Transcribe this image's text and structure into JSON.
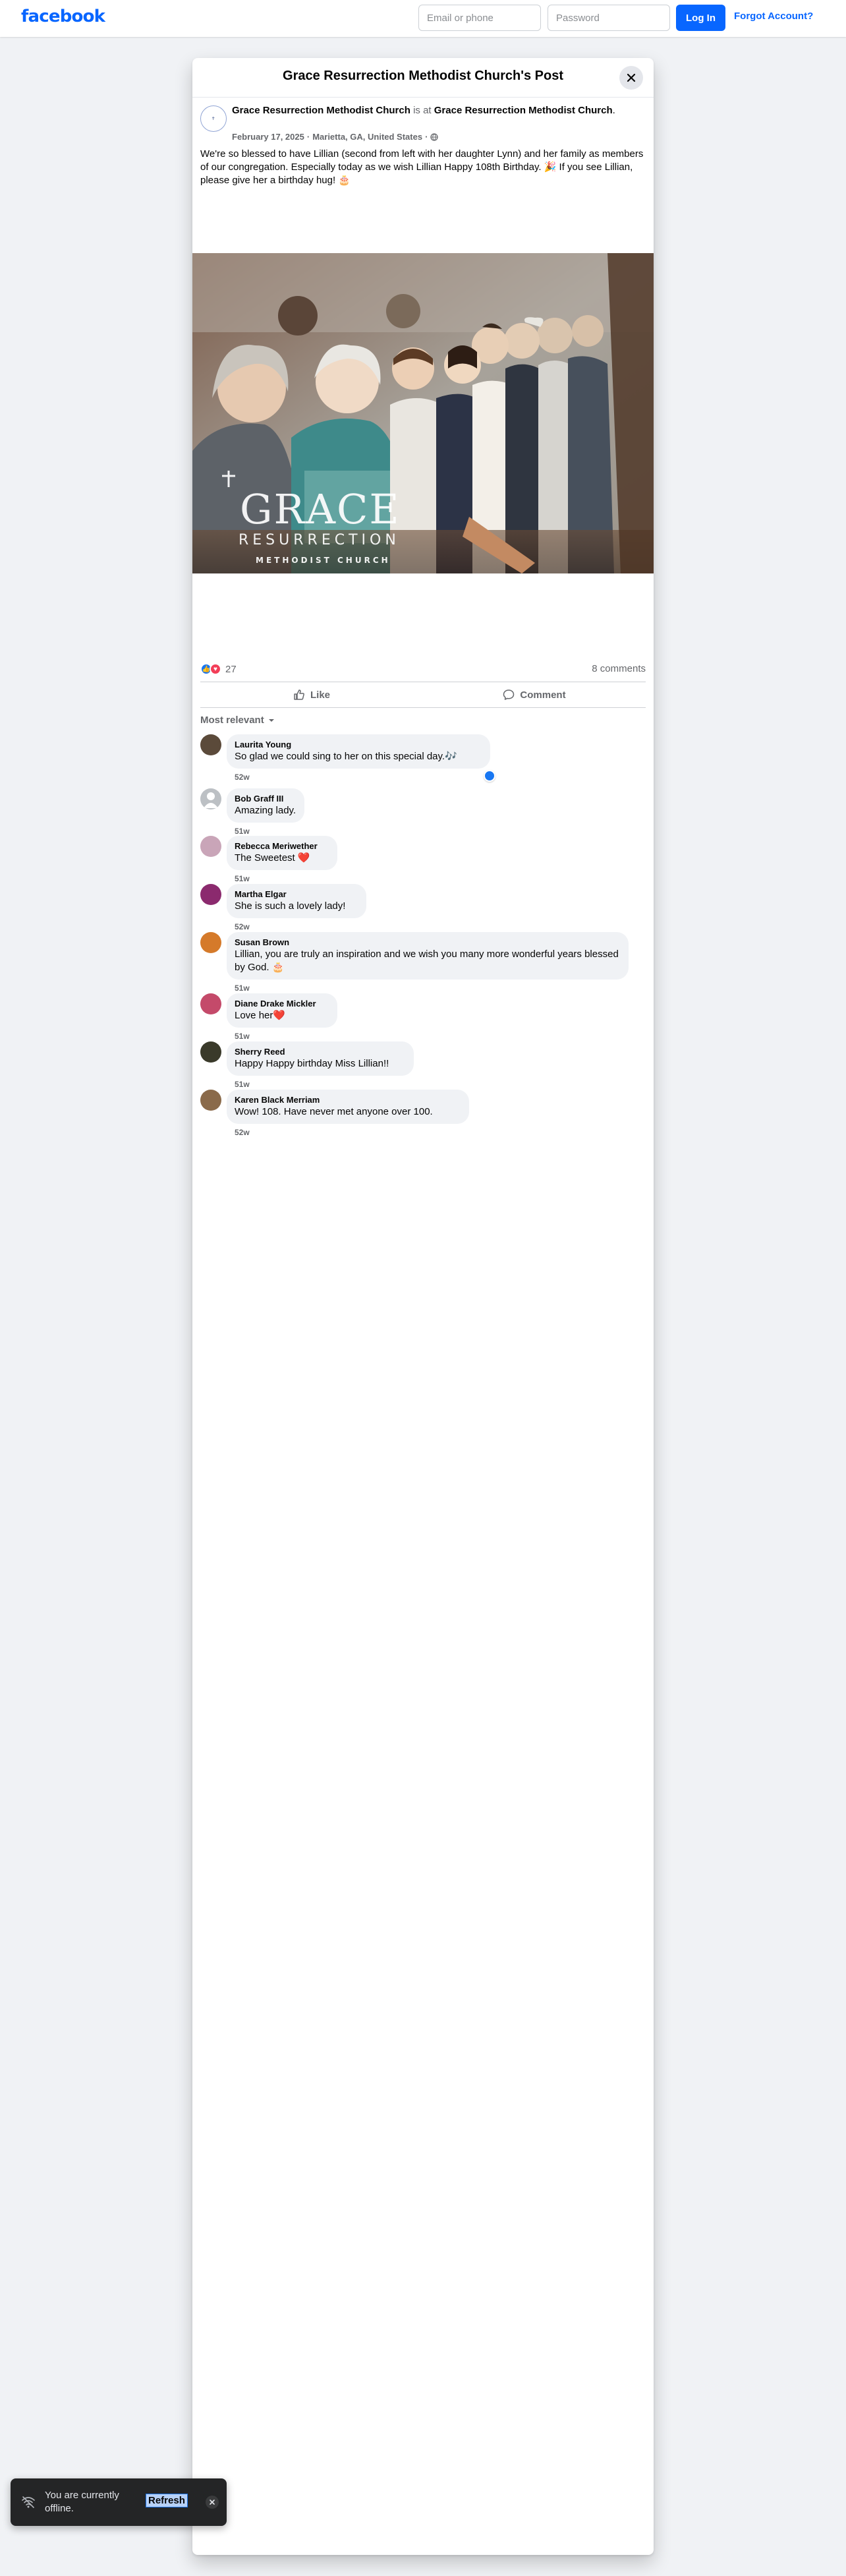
{
  "topbar": {
    "logo": "facebook",
    "email_placeholder": "Email or phone",
    "password_placeholder": "Password",
    "login_label": "Log In",
    "forgot_label": "Forgot Account?"
  },
  "post": {
    "header_title": "Grace Resurrection Methodist Church's Post",
    "author": "Grace Resurrection Methodist Church",
    "is_at": "is at",
    "location_name": "Grace Resurrection Methodist Church",
    "location_suffix": ".",
    "date": "February 17, 2025",
    "place": "Marietta, GA, United States",
    "meta_sep": "·",
    "text": "We're so blessed to have Lillian (second from left with her daughter Lynn) and her family as members of our congregation. Especially today as we wish Lillian Happy 108th Birthday. 🎉 If you see Lillian, please give her a birthday hug! 🎂",
    "photo_logo_main": "GRACE",
    "photo_logo_sub": "RESURRECTION",
    "photo_logo_small": "METHODIST CHURCH",
    "reaction_count": "27",
    "comments_count": "8 comments",
    "like_label": "Like",
    "comment_label": "Comment",
    "sort_label": "Most relevant"
  },
  "comments": [
    {
      "name": "Laurita Young",
      "text": "So glad we could sing to her on this special day.🎶",
      "time": "52w",
      "avatar_color": "#5b4a3a",
      "liked": true
    },
    {
      "name": "Bob Graff III",
      "text": "Amazing lady.",
      "time": "51w",
      "avatar_color": "#bcc0c4",
      "liked": false
    },
    {
      "name": "Rebecca Meriwether",
      "text": "The Sweetest ❤️",
      "time": "51w",
      "avatar_color": "#c9a5b8",
      "liked": false
    },
    {
      "name": "Martha Elgar",
      "text": "She is such a lovely lady!",
      "time": "52w",
      "avatar_color": "#8b2a6e",
      "liked": false
    },
    {
      "name": "Susan Brown",
      "text": "Lillian, you are truly an inspiration and we wish you many more wonderful years blessed by God. 🎂",
      "time": "51w",
      "avatar_color": "#d57a2a",
      "liked": false
    },
    {
      "name": "Diane Drake Mickler",
      "text": "Love her❤️",
      "time": "51w",
      "avatar_color": "#c44a6a",
      "liked": false
    },
    {
      "name": "Sherry Reed",
      "text": "Happy Happy birthday Miss Lillian!!",
      "time": "51w",
      "avatar_color": "#3a3a2a",
      "liked": false
    },
    {
      "name": "Karen Black Merriam",
      "text": "Wow! 108. Have never met anyone over 100.",
      "time": "52w",
      "avatar_color": "#8a6a4a",
      "liked": false
    }
  ],
  "toast": {
    "text": "You are currently offline.",
    "refresh_label": "Refresh"
  },
  "colors": {
    "brand": "#0866ff",
    "like": "#1877f2",
    "love": "#f33e58"
  }
}
